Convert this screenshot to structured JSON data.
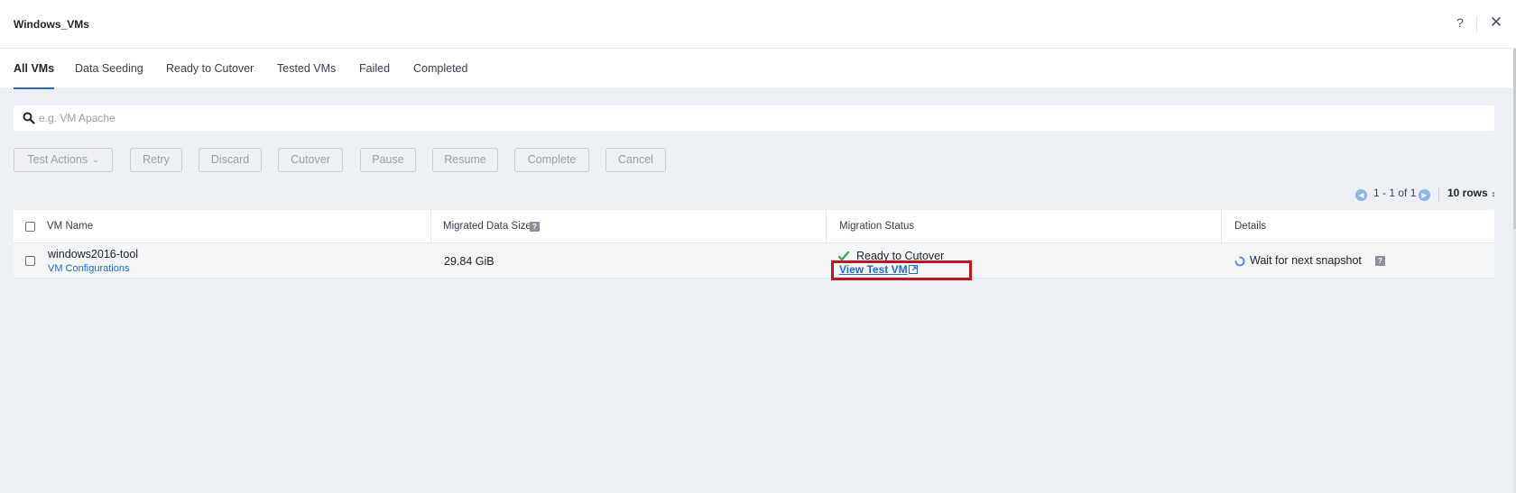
{
  "window": {
    "title": "Windows_VMs",
    "help_label": "?",
    "close_label": "✕"
  },
  "tabs": [
    {
      "label": "All VMs",
      "active": true
    },
    {
      "label": "Data Seeding"
    },
    {
      "label": "Ready to Cutover"
    },
    {
      "label": "Tested VMs"
    },
    {
      "label": "Failed"
    },
    {
      "label": "Completed"
    }
  ],
  "search": {
    "placeholder": "e.g. VM Apache",
    "value": ""
  },
  "toolbar": {
    "test_actions": "Test Actions",
    "retry": "Retry",
    "discard": "Discard",
    "cutover": "Cutover",
    "pause": "Pause",
    "resume": "Resume",
    "complete": "Complete",
    "cancel": "Cancel"
  },
  "pagination": {
    "range": "1 - 1 of 1",
    "rows": "10 rows"
  },
  "table": {
    "headers": {
      "vm_name": "VM Name",
      "migrated_size": "Migrated Data Size",
      "migration_status": "Migration Status",
      "details": "Details"
    },
    "rows": [
      {
        "vm_name": "windows2016-tool",
        "config_link": "VM Configurations",
        "migrated_size": "29.84 GiB",
        "status": "Ready to Cutover",
        "status_link": "View Test VM",
        "details": "Wait for next snapshot"
      }
    ]
  },
  "colors": {
    "accent": "#1b6ce0",
    "status_ok": "#2ea84a",
    "highlight": "#c8131c"
  },
  "icons": [
    "question-icon",
    "close-icon",
    "search-icon",
    "chevron-down-icon",
    "chevron-left-icon",
    "chevron-right-icon",
    "sort-caret-icon",
    "info-icon",
    "check-icon",
    "external-link-icon",
    "spinner-icon"
  ]
}
